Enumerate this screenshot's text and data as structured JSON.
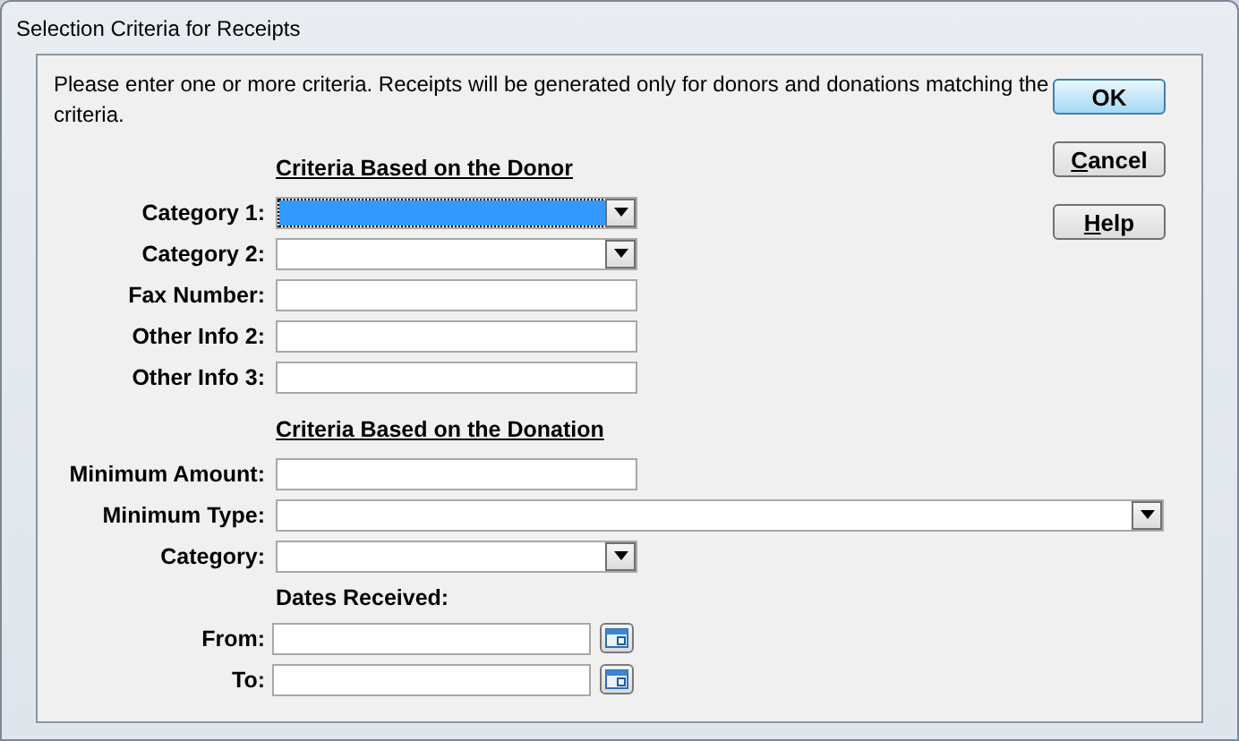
{
  "window": {
    "title": "Selection Criteria for Receipts"
  },
  "intro": "Please enter one or more criteria. Receipts will be generated only for donors and donations matching the criteria.",
  "sections": [
    {
      "heading": "Criteria Based on the Donor",
      "fields": [
        {
          "kind": "combo",
          "label": "Category 1:",
          "focused": true
        },
        {
          "kind": "combo",
          "label": "Category 2:",
          "focused": false
        },
        {
          "kind": "text",
          "label": "Fax Number:",
          "focused": false
        },
        {
          "kind": "text",
          "label": "Other Info 2:",
          "focused": false
        },
        {
          "kind": "text",
          "label": "Other Info 3:",
          "focused": false
        }
      ]
    },
    {
      "heading": "Criteria Based on the Donation",
      "fields": [
        {
          "kind": "text",
          "label": "Minimum Amount:",
          "focused": false
        },
        {
          "kind": "wide-combo",
          "label": "Minimum Type:",
          "focused": false
        },
        {
          "kind": "combo",
          "label": "Category:",
          "focused": false
        },
        {
          "kind": "caption",
          "label": "Dates Received:"
        },
        {
          "kind": "date",
          "label": "From:",
          "focused": false
        },
        {
          "kind": "date",
          "label": "To:",
          "focused": false
        }
      ]
    }
  ],
  "buttons": [
    {
      "label": "OK",
      "default": true,
      "access_key": false
    },
    {
      "label": "Cancel",
      "default": false,
      "access_key": true
    },
    {
      "label": "Help",
      "default": false,
      "access_key": true
    }
  ]
}
